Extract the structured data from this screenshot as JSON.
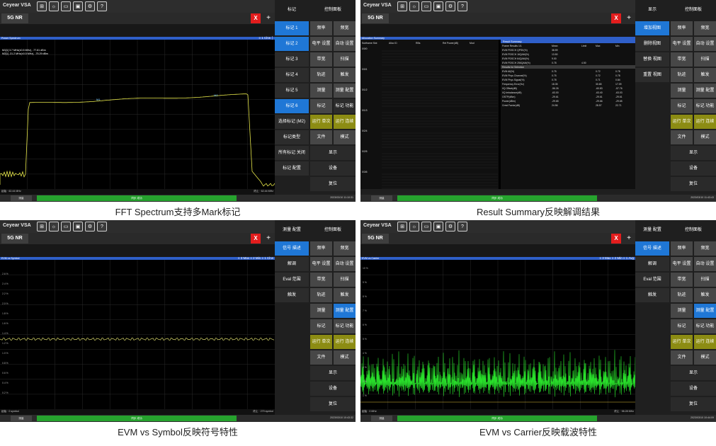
{
  "app": {
    "brand": "Ceyear VSA",
    "mode_tab": "5G NR",
    "close": "X",
    "add": "+"
  },
  "toolbar_icons": [
    "windows-icon",
    "bulb-icon",
    "folder-icon",
    "save-icon",
    "gear-icon",
    "help-icon"
  ],
  "toolbar_glyphs": [
    "⊞",
    "☼",
    "▭",
    "▣",
    "⚙",
    "?"
  ],
  "status": {
    "tab": "测量",
    "green": "同步 成功"
  },
  "panels": [
    {
      "id": "fft",
      "caption": "FFT Spectrum支持多Mark标记",
      "plot_name": "Power Spectrum",
      "plot_info": "≡ 1 Clrw ┆",
      "foot_left": "起始 · 62.44 MHz",
      "foot_right": "终止 · 62.44 MHz",
      "time": "2023/03/10 11:10:31",
      "markers": [
        "M1[1] 3.7 MHz(±0.5 MHz), -77.81 dBm",
        "M2[1] -31.2 MHz(±0.5 MHz), -75.29 dBm"
      ],
      "m1": "M1",
      "m2": "M2",
      "side_header": "标记",
      "ctrl_header": "控制面板",
      "side_left": [
        "标记 1",
        "标记 2",
        "标记 3",
        "标记 4",
        "标记 5",
        "标记 6",
        "选择标记 (M2)",
        "标记类型",
        "所有标记 关闭",
        "标记 配置"
      ],
      "side_right": [
        "频率",
        "电平 设置",
        "带宽",
        "轨迹",
        "测量",
        "标记",
        "运行 单次",
        "文件",
        "显示",
        "设备",
        "复位"
      ],
      "side_right2": [
        "频宽",
        "自动 设置",
        "扫描",
        "触发",
        "测量 配置",
        "标记 功能",
        "运行 连续",
        "模式"
      ]
    },
    {
      "id": "summary",
      "caption": "Result Summary反映解调结果",
      "plot_name": "Allocation Summary",
      "time": "2023/03/10 11:43:43",
      "side_header": "显示",
      "ctrl_header": "控制面板",
      "side_left": [
        "增加视图",
        "删除视图",
        "替换 视图",
        "重置 视图"
      ],
      "side_right": [
        "频率",
        "电平 设置",
        "带宽",
        "轨迹",
        "测量",
        "标记",
        "运行 单次",
        "文件",
        "显示",
        "设备",
        "复位"
      ],
      "side_right2": [
        "频宽",
        "自动 设置",
        "扫描",
        "触发",
        "测量 配置",
        "标记 功能",
        "运行 连续",
        "模式"
      ],
      "result_title": "Result Summary",
      "result_header": [
        "Frame Results 1/1",
        "Mean",
        "Limit",
        "Max",
        "Min"
      ],
      "result_rows": [
        [
          "EVM PDSCH QPSK(%)",
          "38.59",
          "",
          "",
          ""
        ],
        [
          "EVM PDSCH 16QAM(%)",
          "13.50",
          "",
          "",
          ""
        ],
        [
          "EVM PDSCH 64QAM(%)",
          "9.00",
          "",
          "",
          ""
        ],
        [
          "EVM PDSCH 256QAM(%)",
          "0.78",
          "4.50",
          "",
          ""
        ],
        [
          "Results for Selection",
          "",
          "",
          "",
          ""
        ],
        [
          "EVM All(%)",
          "0.75",
          "",
          "0.72",
          "0.78"
        ],
        [
          "EVM Phys Channel(%)",
          "0.75",
          "",
          "0.72",
          "0.78"
        ],
        [
          "EVM Phys Signal(%)",
          "0.78",
          "",
          "0.71",
          "0.84"
        ],
        [
          "Frequency Error(Hz)",
          "18.35",
          "",
          "30.65",
          "17.09"
        ],
        [
          "I/Q Offset(dB)",
          "-56.26",
          "",
          "-60.83",
          "-57.76"
        ],
        [
          "I/Q Imbalance(dB)",
          "-63.00",
          "",
          "-63.40",
          "-63.03"
        ],
        [
          "OSTP(dBm)",
          "-29.61",
          "",
          "-29.61",
          "-29.61"
        ],
        [
          "Power(dBm)",
          "-29.65",
          "",
          "-29.66",
          "-29.65"
        ],
        [
          "Crest Factor(dB)",
          "24.56",
          "",
          "28.57",
          "22.71"
        ]
      ],
      "alloc_groups": [
        "0/0/0",
        "0/0/1",
        "0/1/2",
        "0/1/3",
        "0/2/4",
        "0/2/5",
        "0/3/6"
      ],
      "alloc_header": [
        "Subframe Slot",
        "Alloc ID",
        "RBs",
        "Rel Power(dB)",
        "Mod"
      ]
    },
    {
      "id": "evmsym",
      "caption": "EVM vs Symbol反映符号特性",
      "plot_name": "EVM vs Symbol",
      "plot_info": "≡ 3 Max ≡ 2 Min ≡ 1 Clrw",
      "foot_left": "起始 · 0 symbol",
      "foot_right": "终止 · 279 symbol",
      "time": "2023/03/10 10:43:32",
      "side_left": [
        "信号 描述",
        "解调",
        "Eval 范围",
        "触发"
      ],
      "side_header": "测量 配置",
      "ctrl_header": "控制面板",
      "side_right": [
        "频率",
        "电平 设置",
        "带宽",
        "轨迹",
        "测量",
        "标记",
        "运行 单次",
        "文件",
        "显示",
        "设备",
        "复位"
      ],
      "side_right2": [
        "频宽",
        "自动 设置",
        "扫描",
        "触发",
        "测量 配置",
        "标记 功能",
        "运行 连续",
        "模式"
      ],
      "yticks": [
        "2.6 %",
        "2.4 %",
        "2.2 %",
        "2.0 %",
        "1.8 %",
        "1.6 %",
        "1.4 %",
        "1.2 %",
        "1.0 %",
        "0.8 %",
        "0.6 %",
        "0.4 %",
        "0.2 %"
      ]
    },
    {
      "id": "evmcar",
      "caption": "EVM vs Carrier反映载波特性",
      "plot_name": "EVM vs Carrier",
      "plot_info": "≡ 3 Max ≡ 2 Min ≡ 1 Avg",
      "foot_left": "起始 · 0 MHz",
      "foot_right": "终止 · 98.28 MHz",
      "time": "2023/03/10 10:44:09",
      "side_left": [
        "信号 描述",
        "解调",
        "Eval 范围",
        "触发"
      ],
      "side_header": "测量 配置",
      "ctrl_header": "控制面板",
      "side_right": [
        "频率",
        "电平 设置",
        "带宽",
        "轨迹",
        "测量",
        "标记",
        "运行 单次",
        "文件",
        "显示",
        "设备",
        "复位"
      ],
      "side_right2": [
        "频宽",
        "自动 设置",
        "扫描",
        "触发",
        "测量 配置",
        "标记 功能",
        "运行 连续",
        "模式"
      ],
      "yticks": [
        "10 %",
        "9 %",
        "8 %",
        "7 %",
        "6 %",
        "5 %",
        "4 %",
        "3 %",
        "2 %",
        "1 %"
      ]
    }
  ]
}
